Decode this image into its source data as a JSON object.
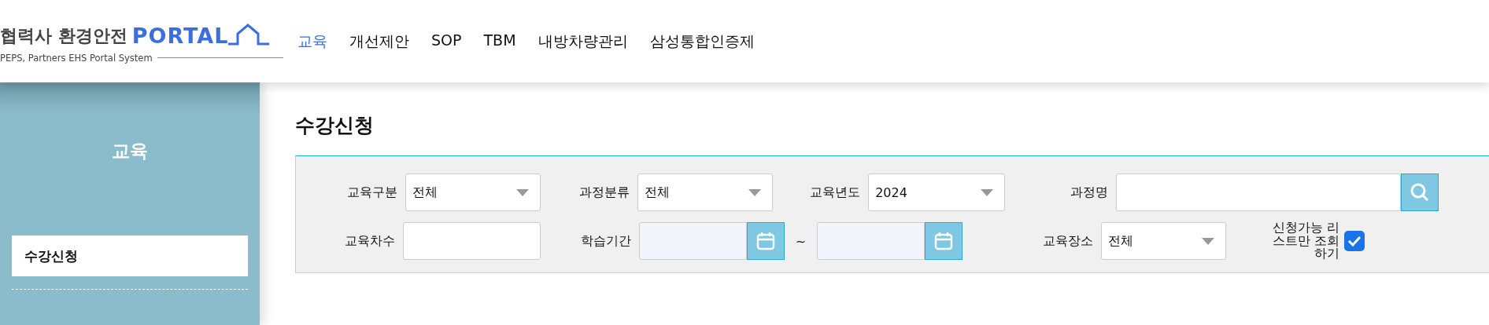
{
  "logo": {
    "title": "협력사 환경안전",
    "brand": "PORTAL",
    "subtitle": "PEPS, Partners EHS Portal System"
  },
  "nav": [
    {
      "label": "교육",
      "selected": true
    },
    {
      "label": "개선제안",
      "selected": false
    },
    {
      "label": "SOP",
      "selected": false
    },
    {
      "label": "TBM",
      "selected": false
    },
    {
      "label": "내방차량관리",
      "selected": false
    },
    {
      "label": "삼성통합인증제",
      "selected": false
    }
  ],
  "sidebar": {
    "title": "교육",
    "items": [
      {
        "label": "수강신청",
        "selected": true
      }
    ]
  },
  "page_title": "수강신청",
  "filter_rows": [
    [
      {
        "kind": "select",
        "label": "교육구분",
        "value": "전체"
      },
      {
        "kind": "select",
        "label": "과정분류",
        "value": "전체"
      },
      {
        "kind": "select",
        "label": "교육년도",
        "value": "2024"
      },
      {
        "kind": "search",
        "label": "과정명"
      }
    ],
    [
      {
        "kind": "text",
        "label": "교육차수"
      },
      {
        "kind": "daterange",
        "label": "학습기간",
        "separator": "~"
      },
      {
        "kind": "select",
        "label": "교육장소",
        "value": "전체"
      },
      {
        "kind": "checkbox",
        "label": "신청가능 리스트만 조회하기",
        "checked": true
      }
    ]
  ]
}
